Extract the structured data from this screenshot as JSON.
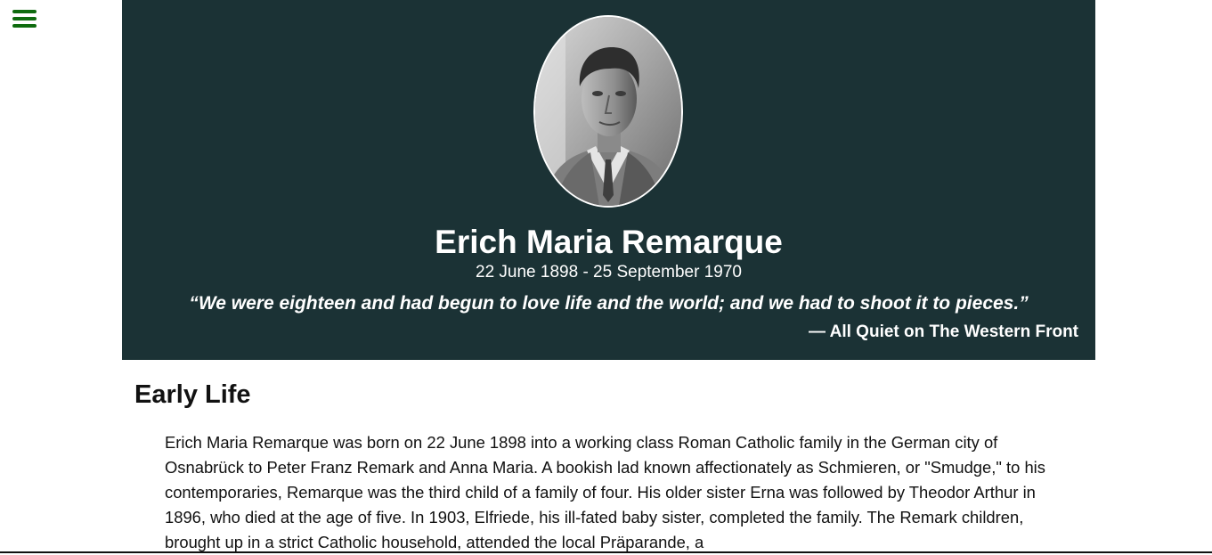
{
  "nav": {
    "menu_icon": "hamburger-icon",
    "menu_color": "#0f6b0f"
  },
  "hero": {
    "background": "#1b3235",
    "portrait_alt": "Portrait of Erich Maria Remarque",
    "name": "Erich Maria Remarque",
    "dates": "22 June 1898 - 25 September 1970",
    "quote": "“We were eighteen and had begun to love life and the world; and we had to shoot it to pieces.”",
    "quote_source": "— All Quiet on The Western Front"
  },
  "sections": {
    "early_life": {
      "title": "Early Life",
      "text": "Erich Maria Remarque was born on 22 June 1898 into a working class Roman Catholic family in the German city of Osnabrück to Peter Franz Remark and Anna Maria. A bookish lad known affectionately as Schmieren, or \"Smudge,\" to his contemporaries, Remarque was the third child of a family of four. His older sister Erna was followed by Theodor Arthur in 1896, who died at the age of five. In 1903, Elfriede, his ill-fated baby sister, completed the family. The Remark children, brought up in a strict Catholic household, attended the local Präparande, a"
    }
  }
}
